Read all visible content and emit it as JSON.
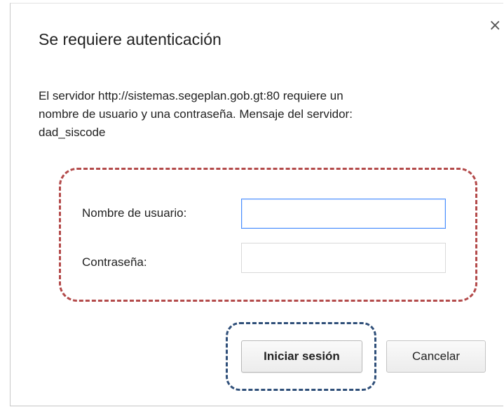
{
  "dialog": {
    "title": "Se requiere autenticación",
    "close_glyph": "×",
    "message_lines": [
      "El servidor http://sistemas.segeplan.gob.gt:80 requiere un",
      "nombre de usuario y una contraseña. Mensaje del servidor:",
      "dad_siscode"
    ]
  },
  "form": {
    "username_label": "Nombre de usuario:",
    "username_value": "",
    "password_label": "Contraseña:",
    "password_value": ""
  },
  "buttons": {
    "login_label": "Iniciar sesión",
    "cancel_label": "Cancelar"
  },
  "annotations": {
    "form_highlight_color": "#b34a4a",
    "button_highlight_color": "#2f4f79"
  },
  "colors": {
    "focus_border": "#4d90fe"
  }
}
